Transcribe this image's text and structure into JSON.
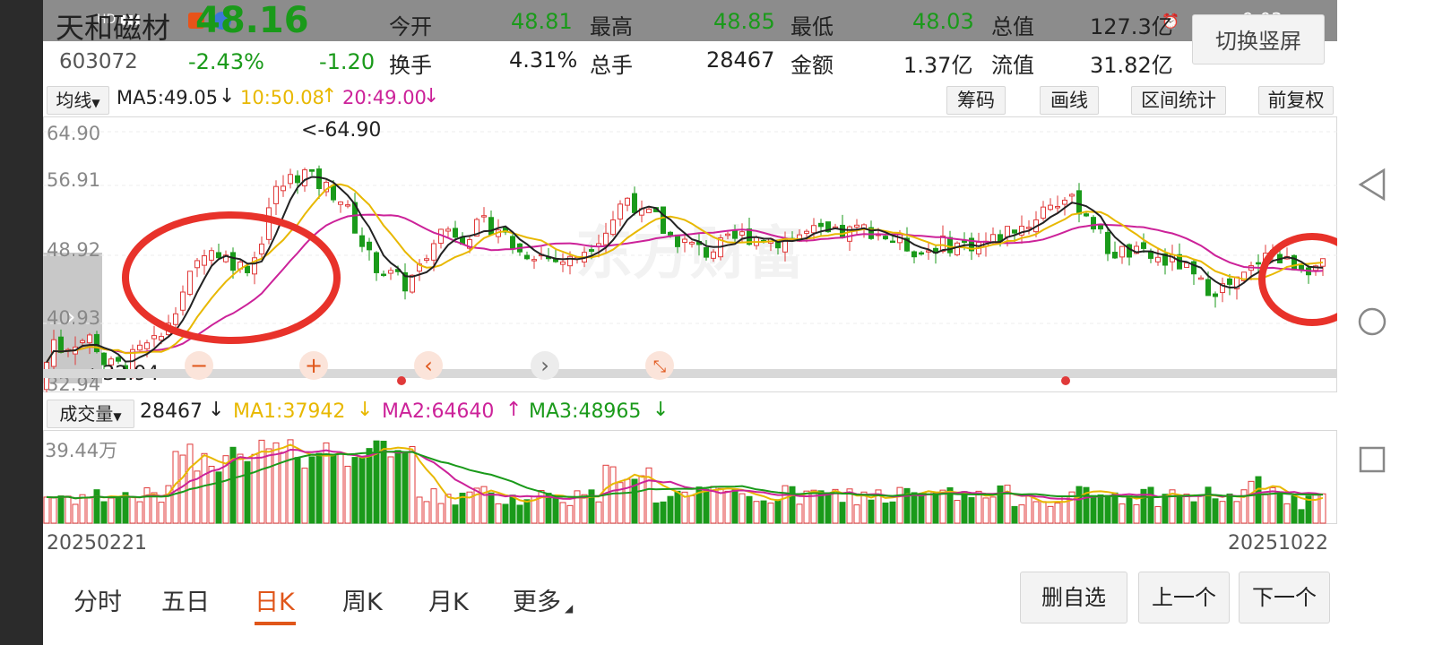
{
  "status": {
    "time": "9:03"
  },
  "header": {
    "stock_name": "天和磁材",
    "price": "48.16",
    "code": "603072",
    "change_pct": "-2.43%",
    "change": "-1.20",
    "switch_button": "切换竖屏",
    "row1": [
      {
        "label": "今开",
        "value": "48.81"
      },
      {
        "label": "最高",
        "value": "48.85"
      },
      {
        "label": "最低",
        "value": "48.03"
      },
      {
        "label": "总值",
        "value": "127.3亿"
      }
    ],
    "row2": [
      {
        "label": "换手",
        "value": "4.31%"
      },
      {
        "label": "总手",
        "value": "28467"
      },
      {
        "label": "金额",
        "value": "1.37亿"
      },
      {
        "label": "流值",
        "value": "31.82亿"
      }
    ]
  },
  "toolbar": {
    "ma_select": "均线",
    "ma5": "MA5:49.05",
    "ma10": "10:50.08",
    "ma20": "20:49.00",
    "buttons": [
      "筹码",
      "画线",
      "区间统计",
      "前复权"
    ]
  },
  "price_axis": {
    "labels": [
      "64.90",
      "56.91",
      "48.92",
      "40.93",
      "32.94"
    ],
    "max_label": "<-64.90",
    "min_label": "<-32.94"
  },
  "watermark": "东方财富",
  "volume": {
    "select": "成交量",
    "value": "28467",
    "ma1": "MA1:37942",
    "ma2": "MA2:64640",
    "ma3": "MA3:48965",
    "axis_label": "39.44万"
  },
  "dates": {
    "start": "20250221",
    "end": "20251022"
  },
  "tabs": [
    "分时",
    "五日",
    "日K",
    "周K",
    "月K",
    "更多"
  ],
  "active_tab": "日K",
  "actions": [
    "删自选",
    "上一个",
    "下一个"
  ],
  "colors": {
    "up": "#e03a3a",
    "down": "#1a9a1a",
    "ma5": "#222222",
    "ma10": "#e8b800",
    "ma20": "#cc2299",
    "accent": "#e0561a"
  }
}
